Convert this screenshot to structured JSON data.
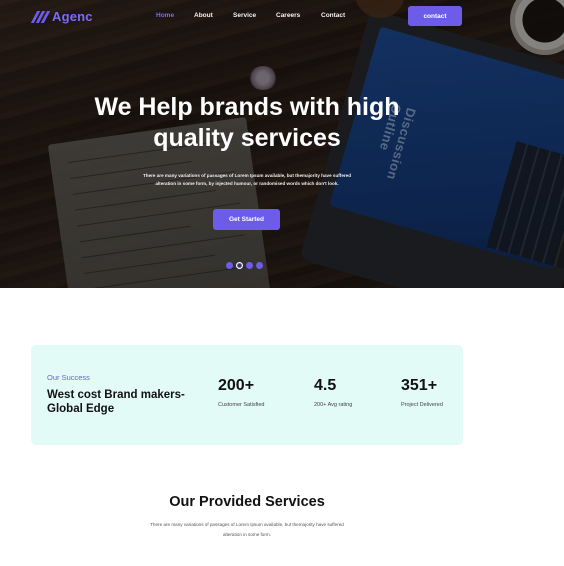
{
  "brand": {
    "name": "Agenc",
    "accent": "#6c5ce7"
  },
  "nav": {
    "items": [
      {
        "label": "Home",
        "active": true
      },
      {
        "label": "About",
        "active": false
      },
      {
        "label": "Service",
        "active": false
      },
      {
        "label": "Careers",
        "active": false
      },
      {
        "label": "Contact",
        "active": false
      }
    ],
    "cta_label": "contact"
  },
  "hero": {
    "title": "We Help brands with high quality services",
    "description": "There are many variations of passages of Lorem Ipsum available, but themajority have suffered alteration in some form, by injected humour, or randomised words which don't look.",
    "button_label": "Get Started",
    "slide_count": 4,
    "active_slide": 2
  },
  "success": {
    "label": "Our Success",
    "title": "West cost Brand makers-Global Edge",
    "background": "#e2fbf6",
    "stats": [
      {
        "value": "200+",
        "label": "Customer Satisfied"
      },
      {
        "value": "4.5",
        "label": "200+ Avg rating"
      },
      {
        "value": "351+",
        "label": "Project Delivered"
      }
    ]
  },
  "services": {
    "title": "Our Provided Services",
    "description": "There are many variations of passages of Lorem Ipsum available, but themajority have suffered alteration in some form."
  }
}
